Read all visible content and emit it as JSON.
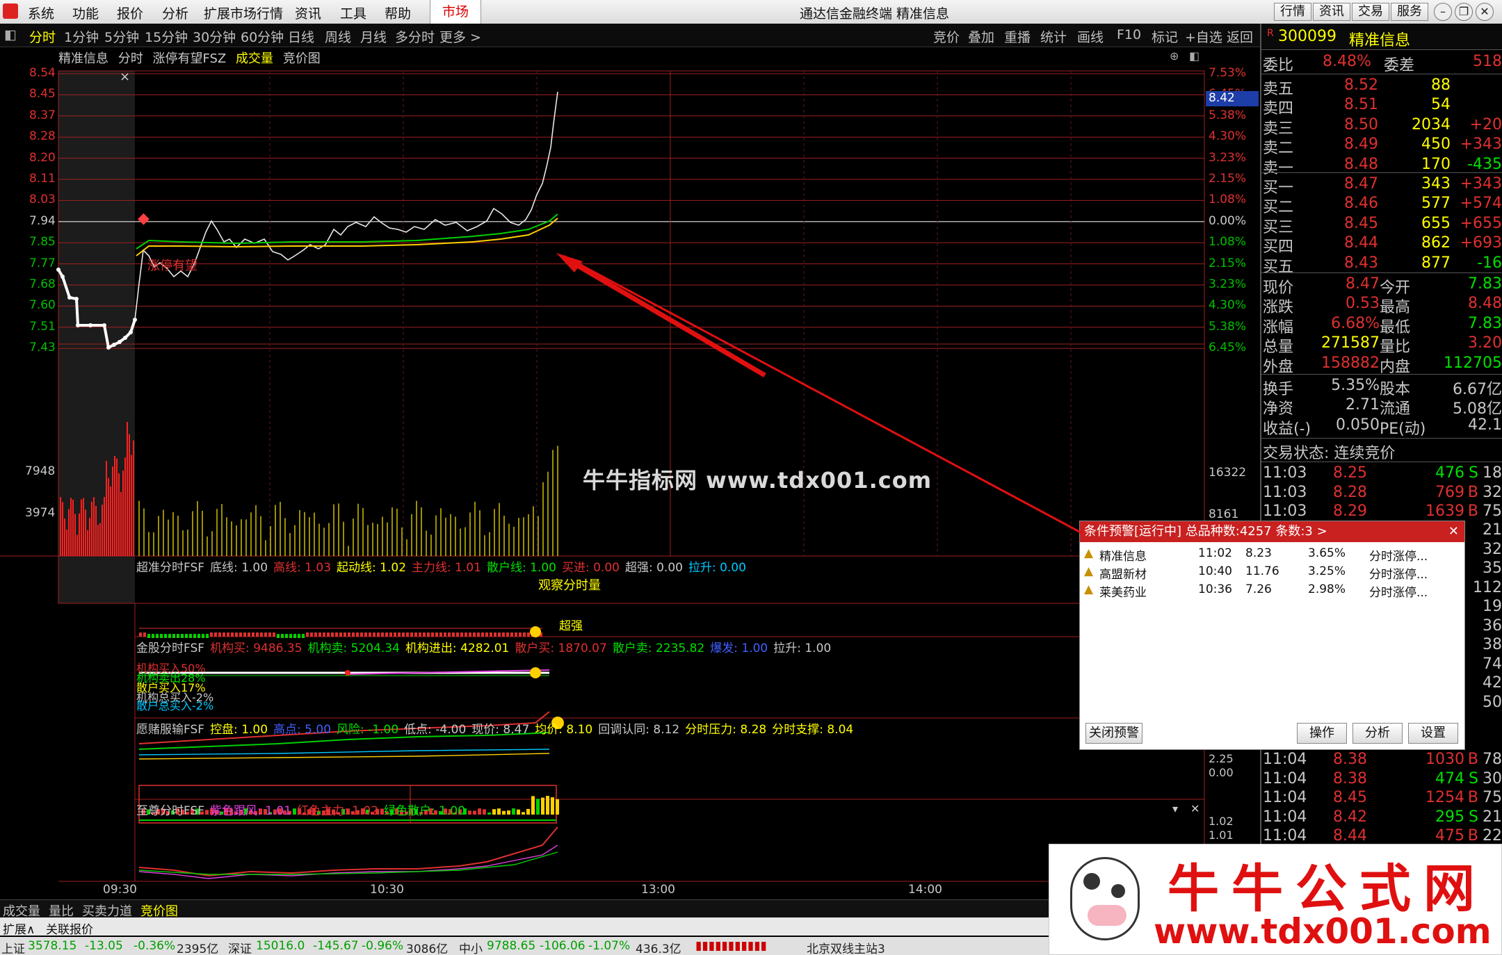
{
  "titlebar": {
    "menus": [
      "系统",
      "功能",
      "报价",
      "分析",
      "扩展市场行情",
      "资讯",
      "工具",
      "帮助"
    ],
    "market": "市场",
    "app_title": "通达信金融终端  精准信息",
    "right_buttons": [
      "行情",
      "资讯",
      "交易",
      "服务"
    ]
  },
  "toolbar": {
    "periods": [
      "分时",
      "1分钟",
      "5分钟",
      "15分钟",
      "30分钟",
      "60分钟",
      "日线",
      "周线",
      "月线",
      "多分时",
      "更多 >"
    ],
    "tools": [
      "竞价",
      "叠加",
      "重播",
      "统计",
      "画线",
      "F10",
      "标记",
      "+自选",
      "返回"
    ]
  },
  "chart": {
    "header": {
      "stock": "精准信息",
      "label1": "分时",
      "label2": "涨停有望FSZ",
      "label3": "成交量",
      "label4": "竞价图"
    },
    "price_ticks": [
      "8.54",
      "8.45",
      "8.37",
      "8.28",
      "8.20",
      "8.11",
      "8.03",
      "7.94",
      "7.85",
      "7.77",
      "7.68",
      "7.60",
      "7.51",
      "7.43"
    ],
    "pct_ticks": [
      "7.53%",
      "6.45%",
      "5.38%",
      "4.30%",
      "3.23%",
      "2.15%",
      "1.08%",
      "0.00%",
      "1.08%",
      "2.15%",
      "3.23%",
      "4.30%",
      "5.38%",
      "6.45%"
    ],
    "current_price_tag": "8.42",
    "vol_ticks_left": [
      "7948",
      "3974"
    ],
    "vol_ticks_right": [
      "16322",
      "8161"
    ],
    "zt_label": "涨停有望",
    "time_ticks": [
      "09:30",
      "10:30",
      "13:00",
      "14:00"
    ],
    "close_x": "×"
  },
  "indicators": {
    "ind1": {
      "name": "超准分时FSF",
      "items": [
        [
          "底线: 1.00",
          "#c8c8c8"
        ],
        [
          "高线: 1.03",
          "#e03030"
        ],
        [
          "起动线: 1.02",
          "#ffff00"
        ],
        [
          "主力线: 1.01",
          "#e03030"
        ],
        [
          "散户线: 1.00",
          "#00e000"
        ],
        [
          "买进: 0.00",
          "#e03030"
        ],
        [
          "超强: 0.00",
          "#c8c8c8"
        ],
        [
          "拉升: 0.00",
          "#00c8ff"
        ]
      ],
      "note1": "观察分时量",
      "note2": "超强"
    },
    "ind2": {
      "name": "金股分时FSF",
      "items": [
        [
          "机构买: 9486.35",
          "#e03030"
        ],
        [
          "机构卖: 5204.34",
          "#00e000"
        ],
        [
          "机构进出: 4282.01",
          "#ffff00"
        ],
        [
          "散户买: 1870.07",
          "#e03030"
        ],
        [
          "散户卖: 2235.82",
          "#00e000"
        ],
        [
          "爆发: 1.00",
          "#4060ff"
        ],
        [
          "拉升: 1.00",
          "#c8c8c8"
        ]
      ],
      "lbl1": "机构买入50%",
      "lbl2": "机构卖出28%",
      "lbl3": "散户买入17%",
      "lbl4": "机构总买入-2%",
      "lbl5": "散户总买入-2%"
    },
    "ind3": {
      "name": "愿赌服输FSF",
      "items": [
        [
          "控盘: 1.00",
          "#ffff00"
        ],
        [
          "高点: 5.00",
          "#4060ff"
        ],
        [
          "风险: -1.00",
          "#00e000"
        ],
        [
          "低点: -4.00",
          "#c8c8c8"
        ],
        [
          "现价: 8.47",
          "#c8c8c8"
        ],
        [
          "均价: 8.10",
          "#ffff00"
        ],
        [
          "回调认同: 8.12",
          "#c8c8c8"
        ],
        [
          "分时压力: 8.28",
          "#ffff00"
        ],
        [
          "分时支撑: 8.04",
          "#ffff00"
        ]
      ],
      "tick1": "2.25",
      "tick2": "0.00"
    },
    "ind4": {
      "name": "至尊分时FSF",
      "items": [
        [
          "紫色跟风: 1.01",
          "#e040e0"
        ],
        [
          "红色主力: 1.02",
          "#e03030"
        ],
        [
          "绿色散户: 1.00",
          "#00e000"
        ]
      ],
      "tick1": "1.02",
      "tick2": "1.01"
    }
  },
  "quote": {
    "code": "300099",
    "name": "精准信息",
    "weibi_label": "委比",
    "weibi": "8.48%",
    "weicha_label": "委差",
    "weicha": "518",
    "asks": [
      {
        "l": "卖五",
        "p": "8.52",
        "v": "88",
        "c": ""
      },
      {
        "l": "卖四",
        "p": "8.51",
        "v": "54",
        "c": ""
      },
      {
        "l": "卖三",
        "p": "8.50",
        "v": "2034",
        "c": "+20"
      },
      {
        "l": "卖二",
        "p": "8.49",
        "v": "450",
        "c": "+343"
      },
      {
        "l": "卖一",
        "p": "8.48",
        "v": "170",
        "c": "-435"
      }
    ],
    "bids": [
      {
        "l": "买一",
        "p": "8.47",
        "v": "343",
        "c": "+343"
      },
      {
        "l": "买二",
        "p": "8.46",
        "v": "577",
        "c": "+574"
      },
      {
        "l": "买三",
        "p": "8.45",
        "v": "655",
        "c": "+655"
      },
      {
        "l": "买四",
        "p": "8.44",
        "v": "862",
        "c": "+693"
      },
      {
        "l": "买五",
        "p": "8.43",
        "v": "877",
        "c": "-16"
      }
    ],
    "stats": [
      {
        "l1": "现价",
        "v1": "8.47",
        "l2": "今开",
        "v2": "7.83",
        "c1": "#e03030",
        "c2": "#00e000"
      },
      {
        "l1": "涨跌",
        "v1": "0.53",
        "l2": "最高",
        "v2": "8.48",
        "c1": "#e03030",
        "c2": "#e03030"
      },
      {
        "l1": "涨幅",
        "v1": "6.68%",
        "l2": "最低",
        "v2": "7.83",
        "c1": "#e03030",
        "c2": "#00e000"
      },
      {
        "l1": "总量",
        "v1": "271587",
        "l2": "量比",
        "v2": "3.20",
        "c1": "#ffff00",
        "c2": "#e03030"
      },
      {
        "l1": "外盘",
        "v1": "158882",
        "l2": "内盘",
        "v2": "112705",
        "c1": "#e03030",
        "c2": "#00e000"
      }
    ],
    "stats2": [
      {
        "l1": "换手",
        "v1": "5.35%",
        "l2": "股本",
        "v2": "6.67亿"
      },
      {
        "l1": "净资",
        "v1": "2.71",
        "l2": "流通",
        "v2": "5.08亿"
      },
      {
        "l1": "收益(-)",
        "v1": "0.050",
        "l2": "PE(动)",
        "v2": "42.1"
      }
    ],
    "trade_state": "交易状态: 连续竞价",
    "ticks_top": [
      {
        "t": "11:03",
        "p": "8.25",
        "v": "476",
        "s": "S",
        "n": "18"
      },
      {
        "t": "11:03",
        "p": "8.28",
        "v": "769",
        "s": "B",
        "n": "32"
      },
      {
        "t": "11:03",
        "p": "8.29",
        "v": "1639",
        "s": "B",
        "n": "75"
      }
    ],
    "ticks_bottom": [
      {
        "t": "11:04",
        "p": "8.38",
        "v": "1030",
        "s": "B",
        "n": "78"
      },
      {
        "t": "11:04",
        "p": "8.38",
        "v": "474",
        "s": "S",
        "n": "30"
      },
      {
        "t": "11:04",
        "p": "8.45",
        "v": "1254",
        "s": "B",
        "n": "75"
      },
      {
        "t": "11:04",
        "p": "8.42",
        "v": "295",
        "s": "S",
        "n": "21"
      },
      {
        "t": "11:04",
        "p": "8.44",
        "v": "475",
        "s": "B",
        "n": "22"
      }
    ],
    "hidden_nums": [
      "21",
      "32",
      "35",
      "112",
      "19",
      "36",
      "38",
      "74",
      "42",
      "50"
    ]
  },
  "alert": {
    "title": "条件预警[运行中] 总品种数:4257 条数:3  >",
    "rows": [
      {
        "name": "精准信息",
        "time": "11:02",
        "price": "8.23",
        "pct": "3.65%",
        "cond": "分时涨停..."
      },
      {
        "name": "高盟新材",
        "time": "10:40",
        "price": "11.76",
        "pct": "3.25%",
        "cond": "分时涨停..."
      },
      {
        "name": "莱美药业",
        "time": "10:36",
        "price": "7.26",
        "pct": "2.98%",
        "cond": "分时涨停..."
      }
    ],
    "btn_close": "关闭预警",
    "btn_op": "操作",
    "btn_an": "分析",
    "btn_set": "设置"
  },
  "bottom_tabs": [
    "成交量",
    "量比",
    "买卖力道",
    "竞价图"
  ],
  "bottom_tabs2": [
    "扩展∧",
    "关联报价"
  ],
  "status": {
    "sh": "上证",
    "sh_v": "3578.15",
    "sh_c": "-13.05",
    "sh_p": "-0.36%",
    "sh_a": "2395亿",
    "sz": "深证",
    "sz_v": "15016.0",
    "sz_c": "-145.67",
    "sz_p": "-0.96%",
    "sz_a": "3086亿",
    "zx": "中小",
    "zx_v": "9788.65",
    "zx_c": "-106.06",
    "zx_p": "-1.07%",
    "zx_a": "436.3亿",
    "server": "北京双线主站3"
  },
  "watermark": {
    "center": "牛牛指标网 www.tdx001.com",
    "brand_cn": "牛牛公式网",
    "brand_url": "www.tdx001.com"
  }
}
